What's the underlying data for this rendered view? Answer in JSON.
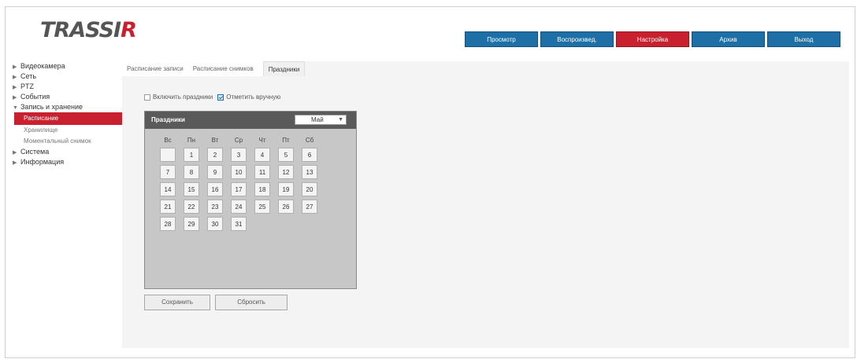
{
  "logo": {
    "text_main": "TRASSI",
    "text_accent": "R"
  },
  "nav": {
    "tabs": [
      {
        "label": "Просмотр",
        "active": false
      },
      {
        "label": "Воспроизвед.",
        "active": false
      },
      {
        "label": "Настройка",
        "active": true
      },
      {
        "label": "Архив",
        "active": false
      },
      {
        "label": "Выход",
        "active": false
      }
    ]
  },
  "sidebar": {
    "items": [
      {
        "label": "Видеокамера"
      },
      {
        "label": "Сеть"
      },
      {
        "label": "PTZ"
      },
      {
        "label": "События"
      },
      {
        "label": "Запись и хранение"
      }
    ],
    "subitems": [
      {
        "label": "Расписание",
        "active": true
      },
      {
        "label": "Хранилище",
        "active": false
      },
      {
        "label": "Моментальный снимок",
        "active": false
      }
    ],
    "items_after": [
      {
        "label": "Система"
      },
      {
        "label": "Информация"
      }
    ]
  },
  "subtabs": [
    {
      "label": "Расписание записи",
      "active": false
    },
    {
      "label": "Расписание снимков",
      "active": false
    },
    {
      "label": "Праздники",
      "active": true
    }
  ],
  "options": {
    "enable_label": "Включить праздники",
    "mark_label": "Отметить вручную"
  },
  "calendar": {
    "title": "Праздники",
    "month": "Май",
    "weekdays": [
      "Вс",
      "Пн",
      "Вт",
      "Ср",
      "Чт",
      "Пт",
      "Сб"
    ],
    "days": [
      "1",
      "2",
      "3",
      "4",
      "5",
      "6",
      "7",
      "8",
      "9",
      "10",
      "11",
      "12",
      "13",
      "14",
      "15",
      "16",
      "17",
      "18",
      "19",
      "20",
      "21",
      "22",
      "23",
      "24",
      "25",
      "26",
      "27",
      "28",
      "29",
      "30",
      "31"
    ]
  },
  "buttons": {
    "apply": "Сохранить",
    "reset": "Сбросить"
  },
  "colors": {
    "accent": "#c8202f",
    "nav": "#1f6fa7"
  }
}
